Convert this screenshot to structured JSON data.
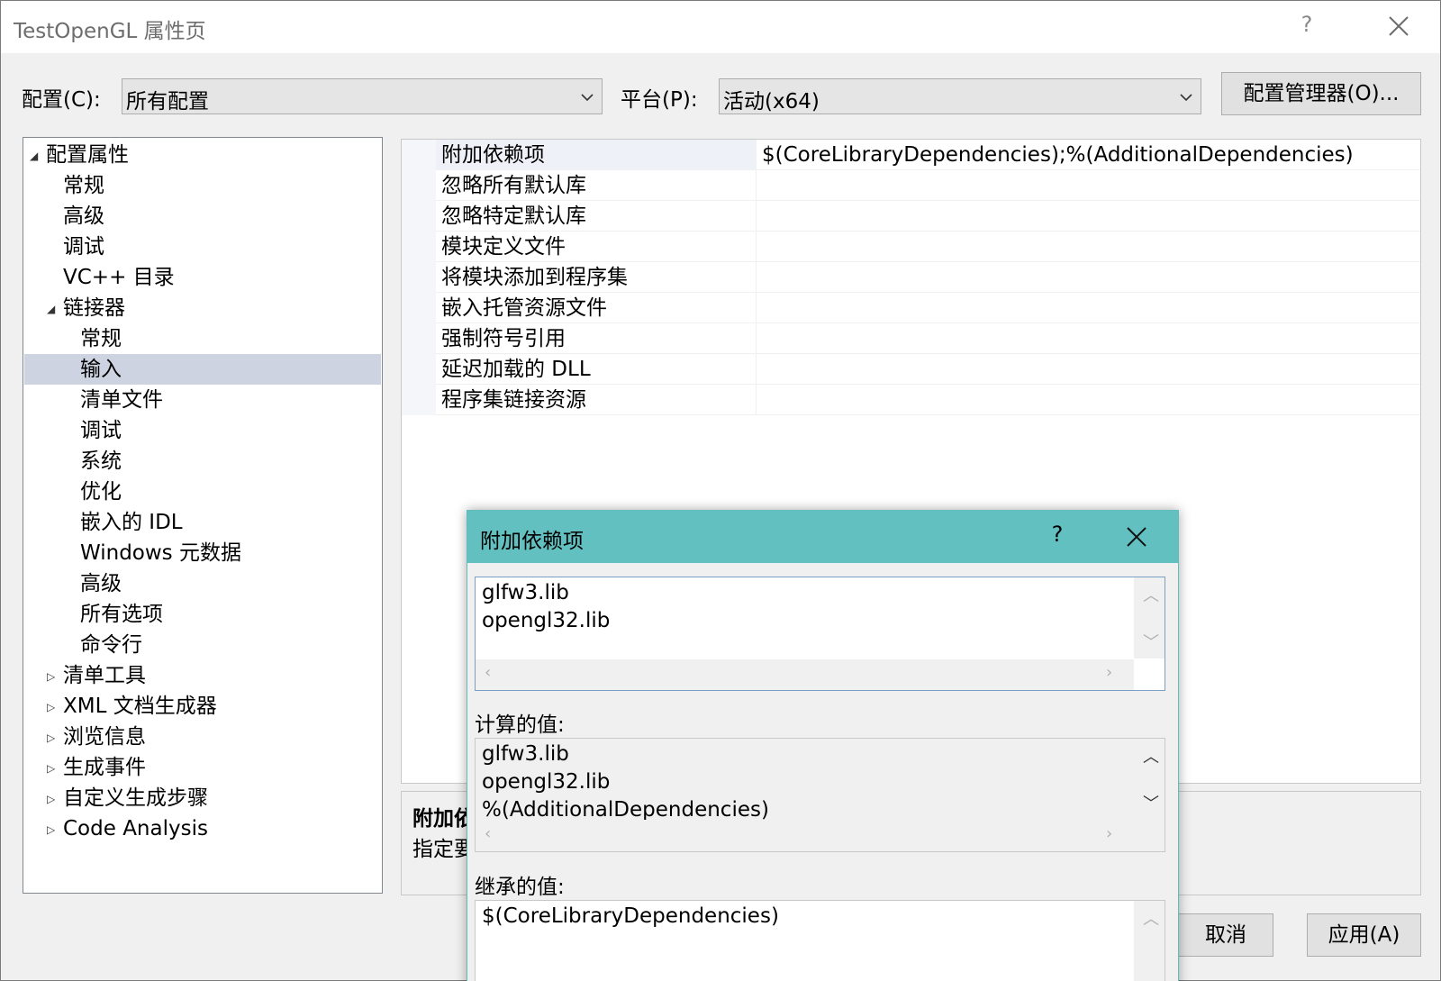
{
  "window": {
    "title": "TestOpenGL 属性页",
    "help": "?"
  },
  "config": {
    "label": "配置(C):",
    "value": "所有配置"
  },
  "platform": {
    "label": "平台(P):",
    "value": "活动(x64)"
  },
  "config_manager_label": "配置管理器(O)...",
  "tree": [
    "配置属性",
    "常规",
    "高级",
    "调试",
    "VC++ 目录",
    "链接器",
    "常规",
    "输入",
    "清单文件",
    "调试",
    "系统",
    "优化",
    "嵌入的 IDL",
    "Windows 元数据",
    "高级",
    "所有选项",
    "命令行",
    "清单工具",
    "XML 文档生成器",
    "浏览信息",
    "生成事件",
    "自定义生成步骤",
    "Code Analysis"
  ],
  "properties": [
    {
      "name": "附加依赖项",
      "value": "$(CoreLibraryDependencies);%(AdditionalDependencies)"
    },
    {
      "name": "忽略所有默认库",
      "value": ""
    },
    {
      "name": "忽略特定默认库",
      "value": ""
    },
    {
      "name": "模块定义文件",
      "value": ""
    },
    {
      "name": "将模块添加到程序集",
      "value": ""
    },
    {
      "name": "嵌入托管资源文件",
      "value": ""
    },
    {
      "name": "强制符号引用",
      "value": ""
    },
    {
      "name": "延迟加载的 DLL",
      "value": ""
    },
    {
      "name": "程序集链接资源",
      "value": ""
    }
  ],
  "description": {
    "title": "附加依",
    "text": "指定要"
  },
  "buttons": {
    "cancel": "取消",
    "apply": "应用(A)"
  },
  "dialog": {
    "title": "附加依赖项",
    "help": "?",
    "edit_lines": [
      "glfw3.lib",
      "opengl32.lib"
    ],
    "computed_label": "计算的值:",
    "computed_lines": [
      "glfw3.lib",
      "opengl32.lib",
      "%(AdditionalDependencies)"
    ],
    "inherited_label": "继承的值:",
    "inherited_lines": [
      "$(CoreLibraryDependencies)"
    ]
  }
}
